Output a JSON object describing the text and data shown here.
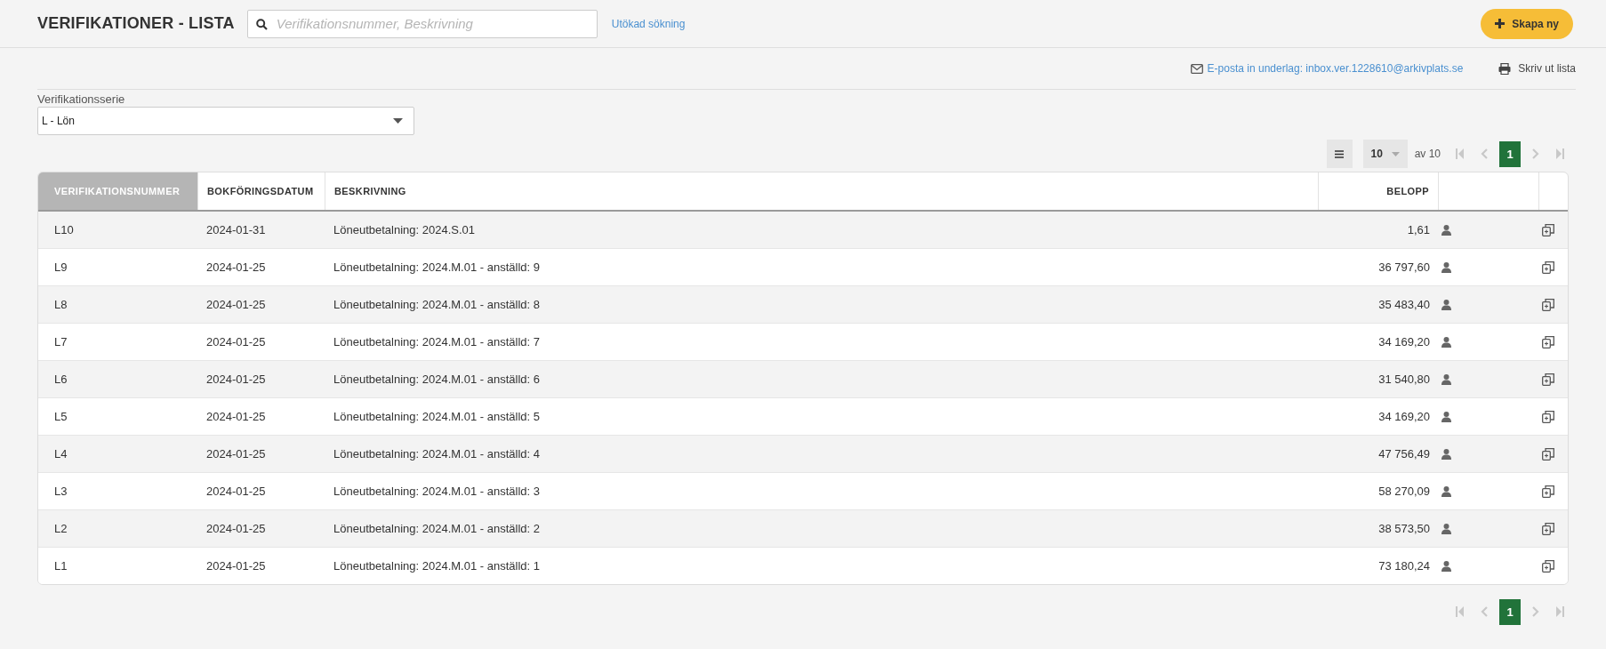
{
  "header": {
    "title": "VERIFIKATIONER - LISTA",
    "search": {
      "placeholder": "Verifikationsnummer, Beskrivning"
    },
    "advanced_search": "Utökad sökning",
    "create_button": "Skapa ny"
  },
  "actions": {
    "email": "E-posta in underlag: inbox.ver.1228610@arkivplats.se",
    "print": "Skriv ut lista"
  },
  "series_filter": {
    "label": "Verifikationsserie",
    "value": "L - Lön"
  },
  "pager_top": {
    "page_size": "10",
    "total": "av 10",
    "pages": [
      {
        "label": "1",
        "selected": true
      }
    ]
  },
  "table": {
    "columns": [
      {
        "label": "VERIFIKATIONSNUMMER",
        "sorted": true
      },
      {
        "label": "BOKFÖRINGSDATUM",
        "sorted": false
      },
      {
        "label": "BESKRIVNING",
        "sorted": false
      },
      {
        "label": "BELOPP",
        "sorted": false
      }
    ],
    "rows": [
      {
        "number": "L10",
        "date": "2024-01-31",
        "description": "Löneutbetalning: 2024.S.01",
        "amount": "1,61"
      },
      {
        "number": "L9",
        "date": "2024-01-25",
        "description": "Löneutbetalning: 2024.M.01 - anställd: 9",
        "amount": "36 797,60"
      },
      {
        "number": "L8",
        "date": "2024-01-25",
        "description": "Löneutbetalning: 2024.M.01 - anställd: 8",
        "amount": "35 483,40"
      },
      {
        "number": "L7",
        "date": "2024-01-25",
        "description": "Löneutbetalning: 2024.M.01 - anställd: 7",
        "amount": "34 169,20"
      },
      {
        "number": "L6",
        "date": "2024-01-25",
        "description": "Löneutbetalning: 2024.M.01 - anställd: 6",
        "amount": "31 540,80"
      },
      {
        "number": "L5",
        "date": "2024-01-25",
        "description": "Löneutbetalning: 2024.M.01 - anställd: 5",
        "amount": "34 169,20"
      },
      {
        "number": "L4",
        "date": "2024-01-25",
        "description": "Löneutbetalning: 2024.M.01 - anställd: 4",
        "amount": "47 756,49"
      },
      {
        "number": "L3",
        "date": "2024-01-25",
        "description": "Löneutbetalning: 2024.M.01 - anställd: 3",
        "amount": "58 270,09"
      },
      {
        "number": "L2",
        "date": "2024-01-25",
        "description": "Löneutbetalning: 2024.M.01 - anställd: 2",
        "amount": "38 573,50"
      },
      {
        "number": "L1",
        "date": "2024-01-25",
        "description": "Löneutbetalning: 2024.M.01 - anställd: 1",
        "amount": "73 180,24"
      }
    ]
  },
  "pager_bottom": {
    "pages": [
      {
        "label": "1",
        "selected": true
      }
    ]
  }
}
